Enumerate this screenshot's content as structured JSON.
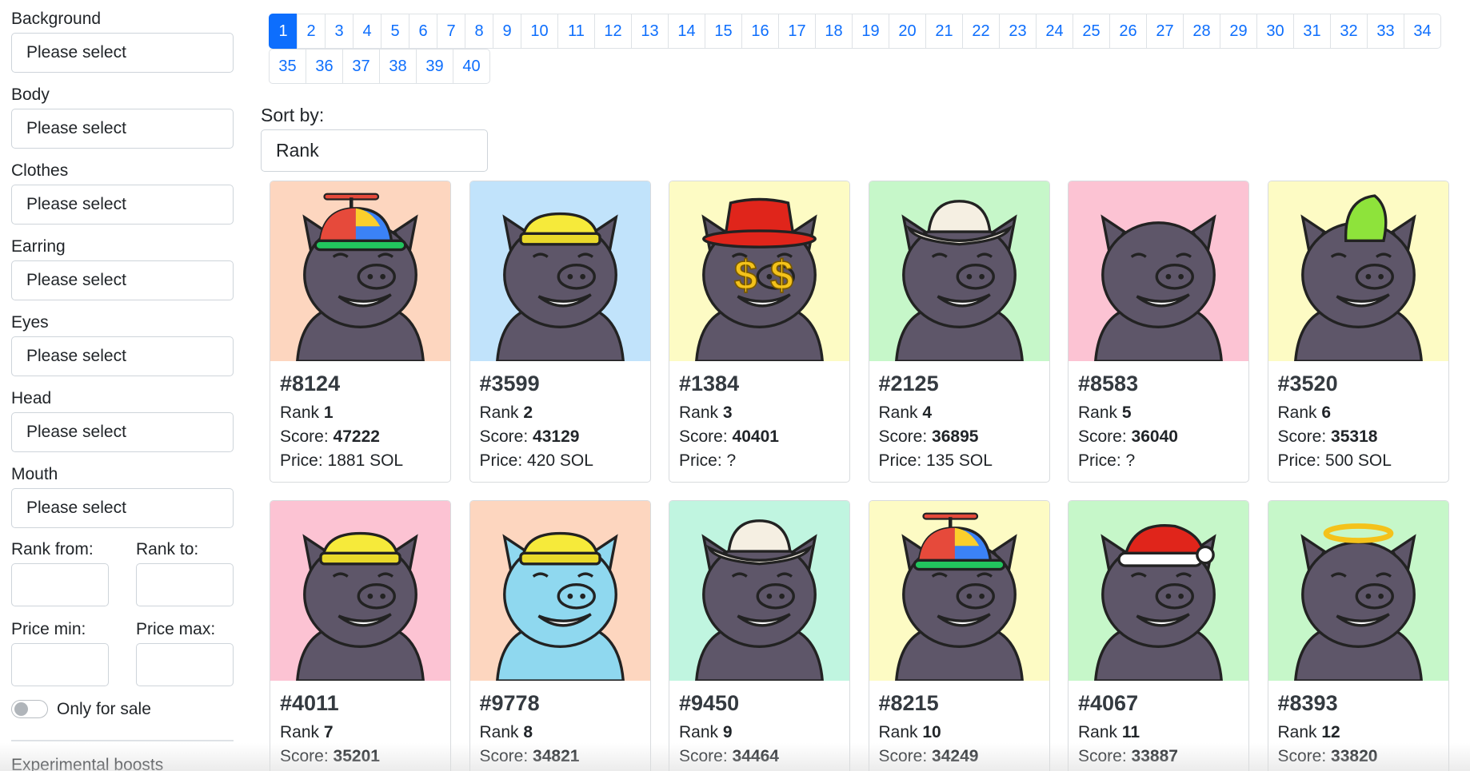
{
  "filters": [
    {
      "label": "Background",
      "value": "Please select"
    },
    {
      "label": "Body",
      "value": "Please select"
    },
    {
      "label": "Clothes",
      "value": "Please select"
    },
    {
      "label": "Earring",
      "value": "Please select"
    },
    {
      "label": "Eyes",
      "value": "Please select"
    },
    {
      "label": "Head",
      "value": "Please select"
    },
    {
      "label": "Mouth",
      "value": "Please select"
    }
  ],
  "range": {
    "rank_from": "Rank from:",
    "rank_to": "Rank to:",
    "price_min": "Price min:",
    "price_max": "Price max:"
  },
  "toggle": {
    "label": "Only for sale",
    "on": false
  },
  "experimental_label": "Experimental boosts",
  "pagination": {
    "pages": [
      "1",
      "2",
      "3",
      "4",
      "5",
      "6",
      "7",
      "8",
      "9",
      "10",
      "11",
      "12",
      "13",
      "14",
      "15",
      "16",
      "17",
      "18",
      "19",
      "20",
      "21",
      "22",
      "23",
      "24",
      "25",
      "26",
      "27",
      "28",
      "29",
      "30",
      "31",
      "32",
      "33",
      "34",
      "35",
      "36",
      "37",
      "38",
      "39",
      "40"
    ],
    "active": "1"
  },
  "sort": {
    "label": "Sort by:",
    "value": "Rank"
  },
  "labels": {
    "rank": "Rank",
    "score": "Score:",
    "price": "Price:"
  },
  "cards": [
    {
      "id": "#8124",
      "rank": "1",
      "score": "47222",
      "price": "1881 SOL",
      "bg": "#fdd6bf",
      "skin": "#5e5669",
      "hat": "propeller"
    },
    {
      "id": "#3599",
      "rank": "2",
      "score": "43129",
      "price": "420 SOL",
      "bg": "#c1e3fb",
      "skin": "#5e5669",
      "hat": "sailor"
    },
    {
      "id": "#1384",
      "rank": "3",
      "score": "40401",
      "price": "?",
      "bg": "#fdfbc4",
      "skin": "#5e5669",
      "hat": "fedora"
    },
    {
      "id": "#2125",
      "rank": "4",
      "score": "36895",
      "price": "135 SOL",
      "bg": "#c6f7c9",
      "skin": "#5e5669",
      "hat": "cowboy"
    },
    {
      "id": "#8583",
      "rank": "5",
      "score": "36040",
      "price": "?",
      "bg": "#fcc3d3",
      "skin": "#5e5669",
      "hat": "none"
    },
    {
      "id": "#3520",
      "rank": "6",
      "score": "35318",
      "price": "500 SOL",
      "bg": "#fdfbc4",
      "skin": "#5e5669",
      "hat": "mohawk"
    },
    {
      "id": "#4011",
      "rank": "7",
      "score": "35201",
      "price": "",
      "bg": "#fcc3d3",
      "skin": "#5e5669",
      "hat": "sailor"
    },
    {
      "id": "#9778",
      "rank": "8",
      "score": "34821",
      "price": "",
      "bg": "#fdd6bf",
      "skin": "#8fd8ef",
      "hat": "sailor"
    },
    {
      "id": "#9450",
      "rank": "9",
      "score": "34464",
      "price": "",
      "bg": "#c0f5e0",
      "skin": "#5e5669",
      "hat": "cowboy"
    },
    {
      "id": "#8215",
      "rank": "10",
      "score": "34249",
      "price": "",
      "bg": "#fdfbc4",
      "skin": "#5e5669",
      "hat": "propeller"
    },
    {
      "id": "#4067",
      "rank": "11",
      "score": "33887",
      "price": "",
      "bg": "#c6f7c9",
      "skin": "#5e5669",
      "hat": "santa"
    },
    {
      "id": "#8393",
      "rank": "12",
      "score": "33820",
      "price": "",
      "bg": "#c6f7c9",
      "skin": "#5e5669",
      "hat": "halo"
    }
  ]
}
